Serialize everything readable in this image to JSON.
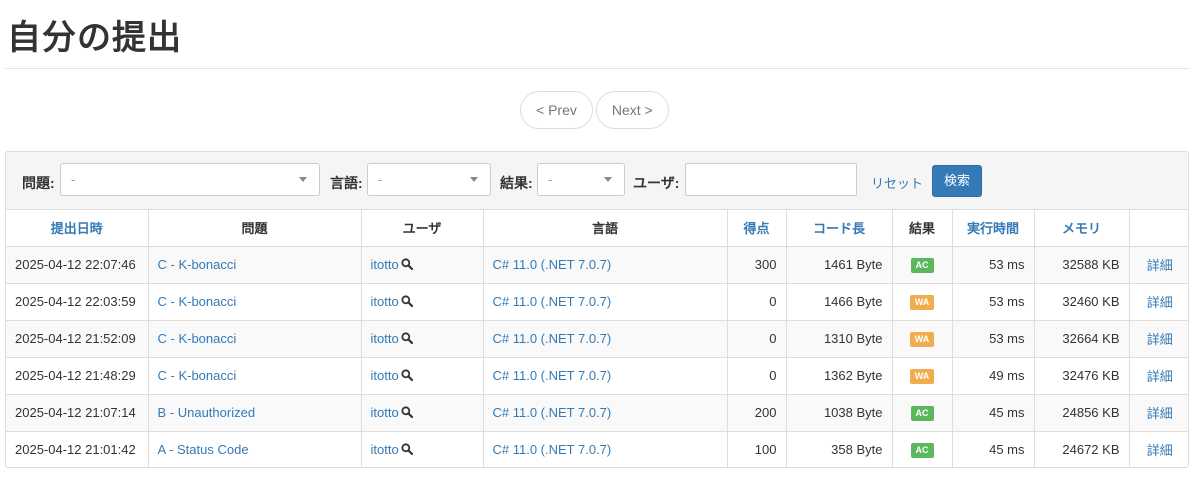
{
  "page_title": "自分の提出",
  "pager": {
    "prev": "< Prev",
    "next": "Next >"
  },
  "filter": {
    "problem_label": "問題:",
    "problem_value": "-",
    "language_label": "言語:",
    "language_value": "-",
    "result_label": "結果:",
    "result_value": "-",
    "user_label": "ユーザ:",
    "user_value": "",
    "reset": "リセット",
    "search": "検索"
  },
  "columns": [
    "提出日時",
    "問題",
    "ユーザ",
    "言語",
    "得点",
    "コード長",
    "結果",
    "実行時間",
    "メモリ",
    ""
  ],
  "rows": [
    {
      "time": "2025-04-12 22:07:46",
      "problem": "C - K-bonacci",
      "user": "itotto",
      "lang": "C# 11.0 (.NET 7.0.7)",
      "score": "300",
      "code": "1461 Byte",
      "result": "AC",
      "exec": "53 ms",
      "mem": "32588 KB",
      "detail": "詳細"
    },
    {
      "time": "2025-04-12 22:03:59",
      "problem": "C - K-bonacci",
      "user": "itotto",
      "lang": "C# 11.0 (.NET 7.0.7)",
      "score": "0",
      "code": "1466 Byte",
      "result": "WA",
      "exec": "53 ms",
      "mem": "32460 KB",
      "detail": "詳細"
    },
    {
      "time": "2025-04-12 21:52:09",
      "problem": "C - K-bonacci",
      "user": "itotto",
      "lang": "C# 11.0 (.NET 7.0.7)",
      "score": "0",
      "code": "1310 Byte",
      "result": "WA",
      "exec": "53 ms",
      "mem": "32664 KB",
      "detail": "詳細"
    },
    {
      "time": "2025-04-12 21:48:29",
      "problem": "C - K-bonacci",
      "user": "itotto",
      "lang": "C# 11.0 (.NET 7.0.7)",
      "score": "0",
      "code": "1362 Byte",
      "result": "WA",
      "exec": "49 ms",
      "mem": "32476 KB",
      "detail": "詳細"
    },
    {
      "time": "2025-04-12 21:07:14",
      "problem": "B - Unauthorized",
      "user": "itotto",
      "lang": "C# 11.0 (.NET 7.0.7)",
      "score": "200",
      "code": "1038 Byte",
      "result": "AC",
      "exec": "45 ms",
      "mem": "24856 KB",
      "detail": "詳細"
    },
    {
      "time": "2025-04-12 21:01:42",
      "problem": "A - Status Code",
      "user": "itotto",
      "lang": "C# 11.0 (.NET 7.0.7)",
      "score": "100",
      "code": "358 Byte",
      "result": "AC",
      "exec": "45 ms",
      "mem": "24672 KB",
      "detail": "詳細"
    }
  ],
  "colors": {
    "link": "#337ab7",
    "AC": "#5cb85c",
    "WA": "#f0ad4e"
  },
  "icons": {
    "user_search": "magnifier-icon"
  }
}
